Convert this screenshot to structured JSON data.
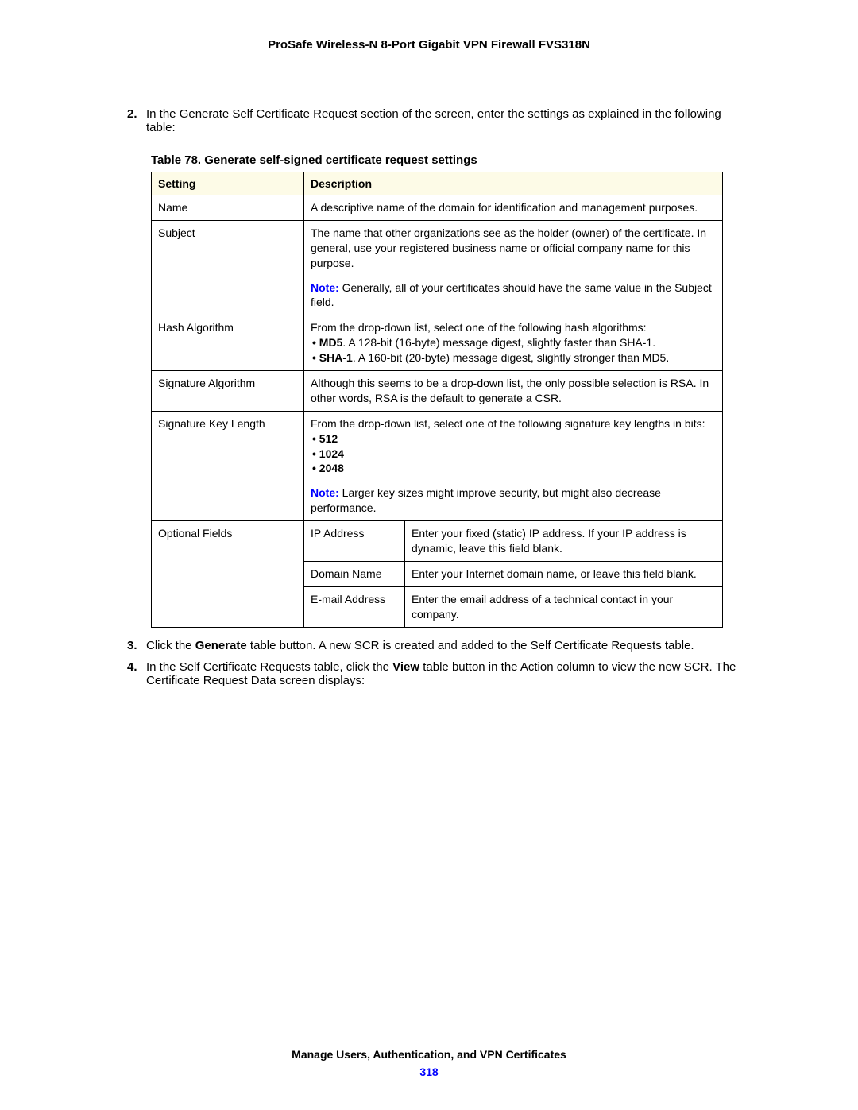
{
  "header": {
    "title": "ProSafe Wireless-N 8-Port Gigabit VPN Firewall FVS318N"
  },
  "steps": {
    "s2": {
      "num": "2.",
      "text": "In the Generate Self Certificate Request section of the screen, enter the settings as explained in the following table:"
    },
    "s3": {
      "num": "3.",
      "t1": "Click the ",
      "b1": "Generate",
      "t2": " table button. A new SCR is created and added to the Self Certificate Requests table."
    },
    "s4": {
      "num": "4.",
      "t1": "In the Self Certificate Requests table, click the ",
      "b1": "View",
      "t2": " table button in the Action column to view the new SCR. The Certificate Request Data screen displays:"
    }
  },
  "table": {
    "caption": "Table 78.  Generate self-signed certificate request settings",
    "head_setting": "Setting",
    "head_desc": "Description",
    "name": {
      "label": "Name",
      "desc": "A descriptive name of the domain for identification and management purposes."
    },
    "subject": {
      "label": "Subject",
      "p1": "The name that other organizations see as the holder (owner) of the certificate. In general, use your registered business name or official company name for this purpose.",
      "note_word": "Note:",
      "note_text": "  Generally, all of your certificates should have the same value in the Subject field."
    },
    "hash": {
      "label": "Hash Algorithm",
      "intro": "From the drop-down list, select one of the following hash algorithms:",
      "b1_bold": "MD5",
      "b1_rest": ". A 128-bit (16-byte) message digest, slightly faster than SHA-1.",
      "b2_bold": "SHA-1",
      "b2_rest": ". A 160-bit (20-byte) message digest, slightly stronger than MD5."
    },
    "sigalg": {
      "label": "Signature Algorithm",
      "desc": "Although this seems to be a drop-down list, the only possible selection is RSA. In other words, RSA is the default to generate a CSR."
    },
    "keylen": {
      "label": "Signature Key Length",
      "intro": "From the drop-down list, select one of the following signature key lengths in bits:",
      "b1": "512",
      "b2": "1024",
      "b3": "2048",
      "note_word": "Note:",
      "note_text": "  Larger key sizes might improve security, but might also decrease performance."
    },
    "optional": {
      "label": "Optional Fields",
      "ip_label": "IP Address",
      "ip_desc": "Enter your fixed (static) IP address. If your IP address is dynamic, leave this field blank.",
      "domain_label": "Domain Name",
      "domain_desc": "Enter your Internet domain name, or leave this field blank.",
      "email_label": "E-mail Address",
      "email_desc": "Enter the email address of a technical contact in your company."
    }
  },
  "footer": {
    "section": "Manage Users, Authentication, and VPN Certificates",
    "page": "318"
  }
}
